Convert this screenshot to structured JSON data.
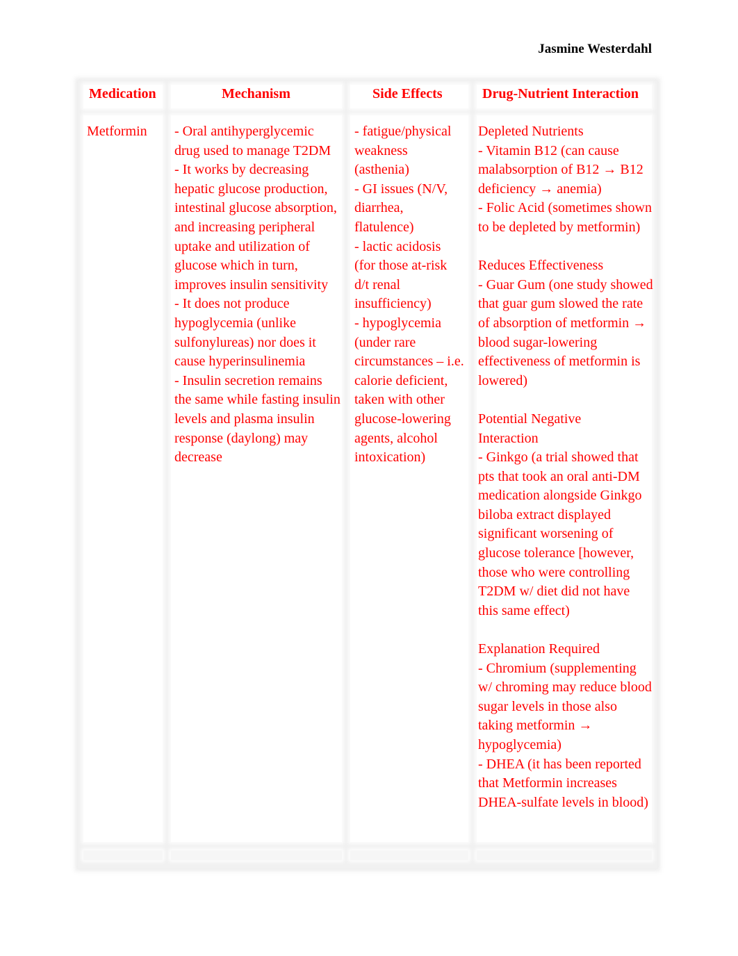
{
  "document": {
    "author": "Jasmine Westerdahl"
  },
  "table": {
    "headers": {
      "medication": "Medication",
      "mechanism": "Mechanism",
      "side_effects": "Side Effects",
      "interaction": "Drug-Nutrient Interaction"
    },
    "rows": [
      {
        "medication": "Metformin",
        "mechanism": "- Oral antihyperglycemic drug used to manage T2DM\n- It works by decreasing hepatic glucose production, intestinal glucose absorption, and increasing peripheral uptake and utilization of glucose which in turn, improves insulin sensitivity\n- It does not produce hypoglycemia (unlike sulfonylureas) nor does it cause hyperinsulinemia\n- Insulin secretion remains the same while fasting insulin levels and plasma insulin response (daylong) may decrease",
        "mechanism_lines": [
          "- Oral antihyperglycemic drug used to manage T2DM",
          "- It works by decreasing hepatic glucose production, intestinal glucose absorption, and increasing peripheral uptake and utilization of glucose which in turn, improves insulin sensitivity",
          "- It does not produce hypoglycemia (unlike sulfonylureas) nor does it cause hyperinsulinemia",
          "- Insulin secretion remains the same while fasting insulin levels and plasma insulin response (daylong) may decrease"
        ],
        "side_effects_lines": [
          "- fatigue/physical weakness (asthenia)",
          "- GI issues (N/V, diarrhea, flatulence)",
          "- lactic acidosis (for those at-risk d/t renal insufficiency)",
          "- hypoglycemia (under rare circumstances – i.e. calorie deficient, taken with other glucose-lowering agents, alcohol intoxication)"
        ],
        "interaction_sections": [
          {
            "title": "Depleted Nutrients",
            "items": [
              "- Vitamin B12 (can cause malabsorption of B12 → B12 deficiency → anemia)",
              "- Folic Acid (sometimes shown to be depleted by metformin)"
            ]
          },
          {
            "title": "Reduces Effectiveness",
            "items": [
              "- Guar Gum (one study showed that guar gum slowed the rate of absorption of metformin → blood sugar-lowering effectiveness of metformin is lowered)"
            ]
          },
          {
            "title": "Potential Negative Interaction",
            "items": [
              "- Ginkgo (a trial showed that pts that took an oral anti-DM medication alongside Ginkgo biloba extract displayed significant worsening of glucose tolerance [however, those who were controlling T2DM w/ diet did not have this same effect)"
            ]
          },
          {
            "title": "Explanation Required",
            "items": [
              "- Chromium (supplementing w/ chroming may reduce blood sugar levels in those also taking metformin → hypoglycemia)",
              "- DHEA (it has been reported that Metformin increases DHEA-sulfate levels in blood)"
            ]
          }
        ]
      },
      {
        "medication": "",
        "mechanism_lines": [],
        "side_effects_lines": [],
        "interaction_sections": []
      }
    ]
  },
  "colors": {
    "text_accent": "#ff0000",
    "author_text": "#000000",
    "border_gray": "#f1f1f1"
  }
}
